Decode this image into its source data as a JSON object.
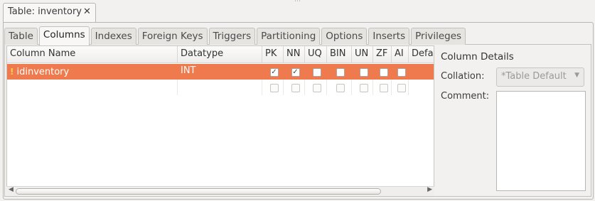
{
  "document_tab": {
    "label": "Table: inventory",
    "close_glyph": "✕"
  },
  "tabs": [
    {
      "label": "Table"
    },
    {
      "label": "Columns",
      "active": true
    },
    {
      "label": "Indexes"
    },
    {
      "label": "Foreign Keys"
    },
    {
      "label": "Triggers"
    },
    {
      "label": "Partitioning"
    },
    {
      "label": "Options"
    },
    {
      "label": "Inserts"
    },
    {
      "label": "Privileges"
    }
  ],
  "grid": {
    "columns": [
      "Column Name",
      "Datatype",
      "PK",
      "NN",
      "UQ",
      "BIN",
      "UN",
      "ZF",
      "AI",
      "Defa"
    ],
    "rows": [
      {
        "name": "idinventory",
        "datatype": "INT",
        "primary_key_icon": "key-icon",
        "flags": {
          "PK": true,
          "NN": true,
          "UQ": false,
          "BIN": false,
          "UN": false,
          "ZF": false,
          "AI": false
        },
        "selected": true
      },
      {
        "name": "",
        "datatype": "",
        "flags": {
          "PK": false,
          "NN": false,
          "UQ": false,
          "BIN": false,
          "UN": false,
          "ZF": false,
          "AI": false
        },
        "selected": false
      }
    ],
    "selected_row_color": "#ee7a4e"
  },
  "details": {
    "title": "Column Details",
    "collation_label": "Collation:",
    "collation_value": "*Table Default",
    "comment_label": "Comment:",
    "comment_value": ""
  }
}
